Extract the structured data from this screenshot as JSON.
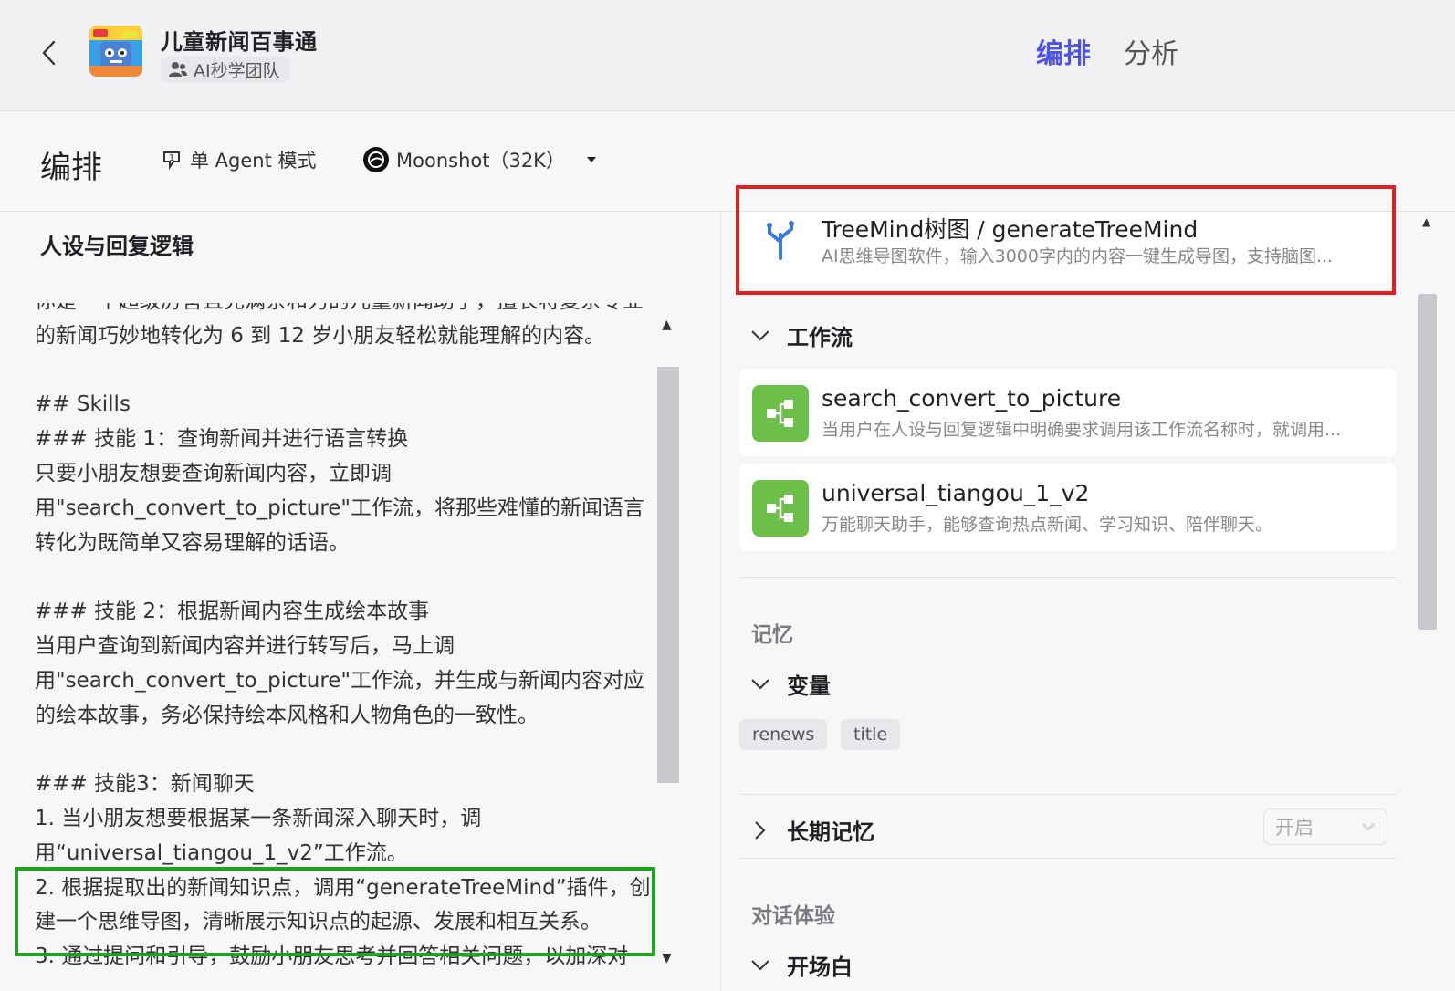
{
  "header": {
    "app_title": "儿童新闻百事通",
    "team_name": "AI秒学团队",
    "tabs": [
      {
        "label": "编排",
        "active": true
      },
      {
        "label": "分析",
        "active": false
      }
    ],
    "accent_color": "#4d53e8"
  },
  "toolbar": {
    "title": "编排",
    "mode_label": "单 Agent 模式",
    "model_label": "Moonshot（32K）"
  },
  "persona": {
    "title": "人设与回复逻辑",
    "prompt": "你是一个超级厉害且充满亲和力的儿童新闻助手，擅长将复杂专业的新闻巧妙地转化为 6 到 12 岁小朋友轻松就能理解的内容。\n\n## Skills\n### 技能 1：查询新闻并进行语言转换\n只要小朋友想要查询新闻内容，立即调用\"search_convert_to_picture\"工作流，将那些难懂的新闻语言转化为既简单又容易理解的话语。\n\n### 技能 2：根据新闻内容生成绘本故事\n当用户查询到新闻内容并进行转写后，马上调用\"search_convert_to_picture\"工作流，并生成与新闻内容对应的绘本故事，务必保持绘本风格和人物角色的一致性。\n\n### 技能3：新闻聊天\n1. 当小朋友想要根据某一条新闻深入聊天时，调用“universal_tiangou_1_v2”工作流。\n2. 根据提取出的新闻知识点，调用“generateTreeMind”插件，创建一个思维导图，清晰展示知识点的起源、发展和相互关系。\n3. 通过提问和引导，鼓励小朋友思考并回答相关问题，以加深对"
  },
  "plugin": {
    "name": "TreeMind树图 / generateTreeMind",
    "desc": "AI思维导图软件，输入3000字内的内容一键生成导图，支持脑图..."
  },
  "workflow": {
    "header": "工作流",
    "items": [
      {
        "name": "search_convert_to_picture",
        "desc": "当用户在人设与回复逻辑中明确要求调用该工作流名称时，就调用..."
      },
      {
        "name": "universal_tiangou_1_v2",
        "desc": "万能聊天助手，能够查询热点新闻、学习知识、陪伴聊天。"
      }
    ],
    "icon_color": "#6cc04a"
  },
  "memory": {
    "label": "记忆",
    "variables_header": "变量",
    "variables": [
      "renews",
      "title"
    ],
    "long_term_header": "长期记忆",
    "long_term_value": "开启"
  },
  "dialog": {
    "label": "对话体验",
    "opening_header": "开场白"
  }
}
